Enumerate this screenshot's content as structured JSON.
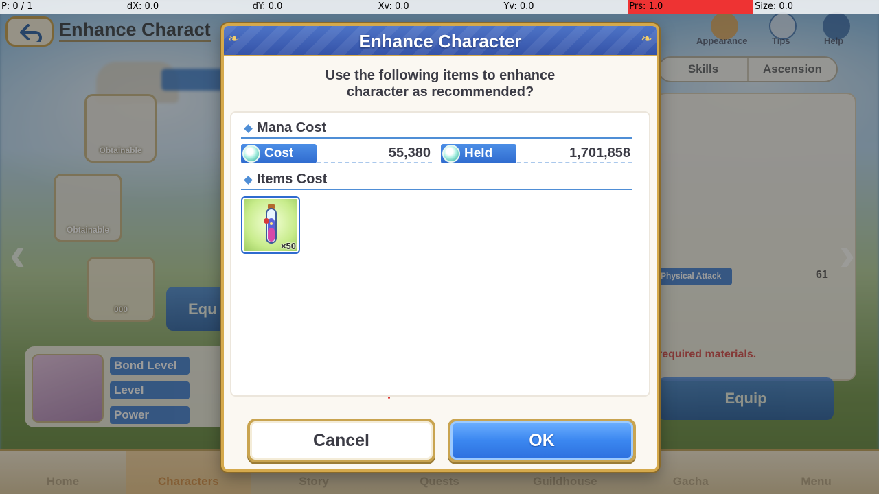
{
  "debug_bar": {
    "pointer": "P: 0 / 1",
    "dx": "dX: 0.0",
    "dy": "dY: 0.0",
    "xv": "Xv: 0.0",
    "yv": "Yv: 0.0",
    "pressure": "Prs: 1.0",
    "size": "Size: 0.0"
  },
  "background": {
    "screen_title": "Enhance Charact",
    "top_icons": [
      "Appearance",
      "Tips",
      "Help"
    ],
    "tabs": [
      "Skills",
      "Ascension"
    ],
    "equip_slots": [
      "Obtainable",
      "Obtainable",
      "000"
    ],
    "physical_attack_label": "Physical Attack",
    "physical_attack_value": "61",
    "required_materials_text": "required materials.",
    "equip_button": "Equip",
    "equip_left": "Equ",
    "stat_labels": [
      "Bond Level",
      "Level",
      "Power"
    ],
    "nav": [
      "Home",
      "Characters",
      "Story",
      "Quests",
      "Guildhouse",
      "Gacha",
      "Menu"
    ]
  },
  "dialog": {
    "title": "Enhance Character",
    "prompt_line1": "Use the following items to enhance",
    "prompt_line2": "character as recommended?",
    "mana_section": "Mana Cost",
    "cost_label": "Cost",
    "cost_value": "55,380",
    "held_label": "Held",
    "held_value": "1,701,858",
    "items_section": "Items Cost",
    "item_icon": "potion-vial-icon",
    "item_quantity": "×50",
    "cancel_label": "Cancel",
    "ok_label": "OK"
  },
  "colors": {
    "accent_blue": "#3b87f0",
    "gold_border": "#d5a94c",
    "header_blue": "#3553a8",
    "alert_red": "#ee3333"
  }
}
